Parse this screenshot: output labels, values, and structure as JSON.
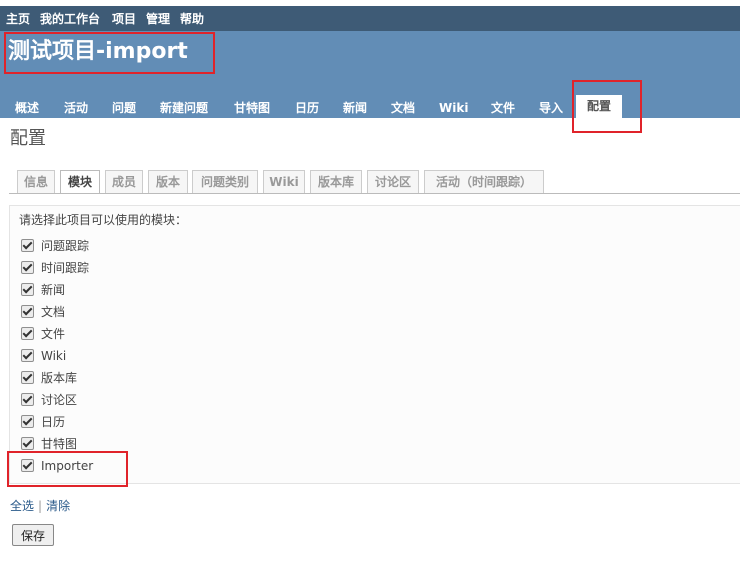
{
  "top_menu": [
    "主页",
    "我的工作台",
    "项目",
    "管理",
    "帮助"
  ],
  "project_title": "测试项目-import",
  "main_tabs": [
    "概述",
    "活动",
    "问题",
    "新建问题",
    "甘特图",
    "日历",
    "新闻",
    "文档",
    "Wiki",
    "文件",
    "导入",
    "配置"
  ],
  "selected_main_tab": "配置",
  "page_heading": "配置",
  "sub_tabs": [
    "信息",
    "模块",
    "成员",
    "版本",
    "问题类别",
    "Wiki",
    "版本库",
    "讨论区",
    "活动（时间跟踪）"
  ],
  "selected_sub_tab": "模块",
  "modules_legend": "请选择此项目可以使用的模块：",
  "modules": [
    {
      "label": "问题跟踪",
      "checked": true
    },
    {
      "label": "时间跟踪",
      "checked": true
    },
    {
      "label": "新闻",
      "checked": true
    },
    {
      "label": "文档",
      "checked": true
    },
    {
      "label": "文件",
      "checked": true
    },
    {
      "label": "Wiki",
      "checked": true
    },
    {
      "label": "版本库",
      "checked": true
    },
    {
      "label": "讨论区",
      "checked": true
    },
    {
      "label": "日历",
      "checked": true
    },
    {
      "label": "甘特图",
      "checked": true
    },
    {
      "label": "Importer",
      "checked": true
    }
  ],
  "select_links": {
    "all": "全选",
    "separator": "|",
    "none": "清除"
  },
  "save_label": "保存",
  "colors": {
    "top_menu": "#3e5b76",
    "header": "#628db6",
    "highlight": "#e0232a",
    "link": "#2a5a8a"
  }
}
